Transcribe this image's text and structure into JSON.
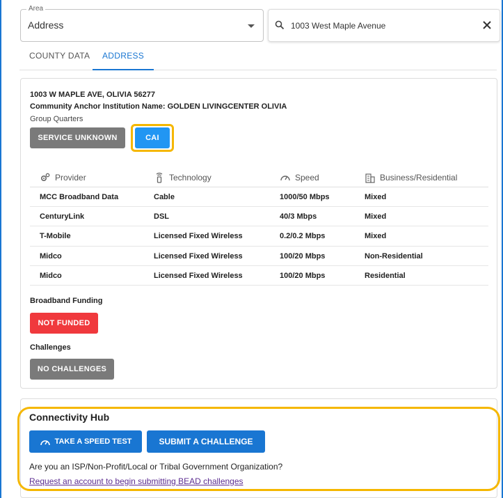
{
  "search": {
    "area_label": "Area",
    "area_value": "Address",
    "query": "1003 West Maple Avenue"
  },
  "tabs": [
    {
      "label": "COUNTY DATA",
      "active": false
    },
    {
      "label": "ADDRESS",
      "active": true
    }
  ],
  "address": {
    "line1": "1003 W MAPLE AVE, OLIVIA 56277",
    "line2": "Community Anchor Institution Name: GOLDEN LIVINGCENTER OLIVIA",
    "type": "Group Quarters",
    "status_label": "SERVICE UNKNOWN",
    "cai_label": "CAI"
  },
  "services": {
    "headers": [
      "Provider",
      "Technology",
      "Speed",
      "Business/Residential"
    ],
    "rows": [
      [
        "MCC Broadband Data",
        "Cable",
        "1000/50 Mbps",
        "Mixed"
      ],
      [
        "CenturyLink",
        "DSL",
        "40/3 Mbps",
        "Mixed"
      ],
      [
        "T-Mobile",
        "Licensed Fixed Wireless",
        "0.2/0.2 Mbps",
        "Mixed"
      ],
      [
        "Midco",
        "Licensed Fixed Wireless",
        "100/20 Mbps",
        "Non-Residential"
      ],
      [
        "Midco",
        "Licensed Fixed Wireless",
        "100/20 Mbps",
        "Residential"
      ]
    ]
  },
  "funding": {
    "label": "Broadband Funding",
    "status": "NOT FUNDED"
  },
  "challenges": {
    "label": "Challenges",
    "status": "NO CHALLENGES"
  },
  "hub": {
    "title": "Connectivity Hub",
    "speed_test_label": "TAKE A SPEED TEST",
    "challenge_label": "SUBMIT A CHALLENGE",
    "question": "Are you an ISP/Non-Profit/Local or Tribal Government Organization?",
    "link": "Request an account to begin submitting BEAD challenges"
  },
  "colors": {
    "accent": "#1976d2",
    "highlight": "#f5b700",
    "danger": "#f0393d",
    "neutral": "#7a7a7a"
  }
}
